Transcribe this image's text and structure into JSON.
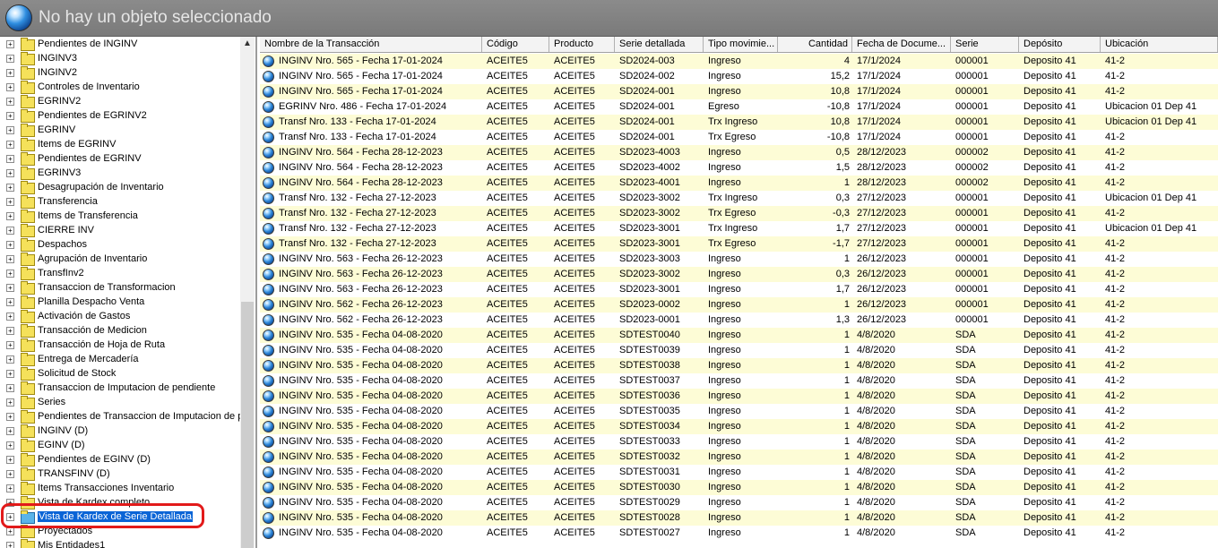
{
  "window": {
    "title": "No hay un objeto seleccionado"
  },
  "tree": {
    "items": [
      {
        "label": "Pendientes de INGINV"
      },
      {
        "label": "INGINV3"
      },
      {
        "label": "INGINV2"
      },
      {
        "label": "Controles de Inventario"
      },
      {
        "label": "EGRINV2"
      },
      {
        "label": "Pendientes de EGRINV2"
      },
      {
        "label": "EGRINV"
      },
      {
        "label": "Items de EGRINV"
      },
      {
        "label": "Pendientes de EGRINV"
      },
      {
        "label": "EGRINV3"
      },
      {
        "label": "Desagrupación de Inventario"
      },
      {
        "label": "Transferencia"
      },
      {
        "label": "Items de Transferencia"
      },
      {
        "label": "CIERRE INV"
      },
      {
        "label": "Despachos"
      },
      {
        "label": "Agrupación de Inventario"
      },
      {
        "label": "TransfInv2"
      },
      {
        "label": "Transaccion de Transformacion"
      },
      {
        "label": "Planilla Despacho Venta"
      },
      {
        "label": "Activación de Gastos"
      },
      {
        "label": "Transacción de Medicion"
      },
      {
        "label": "Transacción de Hoja de Ruta"
      },
      {
        "label": "Entrega de Mercadería"
      },
      {
        "label": "Solicitud de Stock"
      },
      {
        "label": "Transaccion de Imputacion de pendiente"
      },
      {
        "label": "Series"
      },
      {
        "label": "Pendientes de Transaccion de Imputacion de p"
      },
      {
        "label": "INGINV (D)"
      },
      {
        "label": "EGINV (D)"
      },
      {
        "label": "Pendientes de EGINV (D)"
      },
      {
        "label": "TRANSFINV (D)"
      },
      {
        "label": "Items Transacciones Inventario"
      },
      {
        "label": "Vista de Kardex completo"
      },
      {
        "label": "Vista de Kardex de Serie Detallada",
        "selected": true
      },
      {
        "label": "Proyectados"
      },
      {
        "label": "Mis Entidades1"
      }
    ]
  },
  "grid": {
    "columns": [
      "Nombre de la Transacción",
      "Código",
      "Producto",
      "Serie detallada",
      "Tipo movimie...",
      "Cantidad",
      "Fecha de Docume...",
      "Serie",
      "Depósito",
      "Ubicación"
    ],
    "rows": [
      [
        "INGINV Nro.  565 - Fecha 17-01-2024",
        "ACEITE5",
        "ACEITE5",
        "SD2024-003",
        "Ingreso",
        "4",
        "17/1/2024",
        "000001",
        "Deposito 41",
        "41-2"
      ],
      [
        "INGINV Nro.  565 - Fecha 17-01-2024",
        "ACEITE5",
        "ACEITE5",
        "SD2024-002",
        "Ingreso",
        "15,2",
        "17/1/2024",
        "000001",
        "Deposito 41",
        "41-2"
      ],
      [
        "INGINV Nro.  565 - Fecha 17-01-2024",
        "ACEITE5",
        "ACEITE5",
        "SD2024-001",
        "Ingreso",
        "10,8",
        "17/1/2024",
        "000001",
        "Deposito 41",
        "41-2"
      ],
      [
        "EGRINV Nro.  486 - Fecha 17-01-2024",
        "ACEITE5",
        "ACEITE5",
        "SD2024-001",
        "Egreso",
        "-10,8",
        "17/1/2024",
        "000001",
        "Deposito 41",
        "Ubicacion 01 Dep 41"
      ],
      [
        "Transf Nro.  133 - Fecha 17-01-2024",
        "ACEITE5",
        "ACEITE5",
        "SD2024-001",
        "Trx Ingreso",
        "10,8",
        "17/1/2024",
        "000001",
        "Deposito 41",
        "Ubicacion 01 Dep 41"
      ],
      [
        "Transf Nro.  133 - Fecha 17-01-2024",
        "ACEITE5",
        "ACEITE5",
        "SD2024-001",
        "Trx Egreso",
        "-10,8",
        "17/1/2024",
        "000001",
        "Deposito 41",
        "41-2"
      ],
      [
        "INGINV Nro.  564 - Fecha 28-12-2023",
        "ACEITE5",
        "ACEITE5",
        "SD2023-4003",
        "Ingreso",
        "0,5",
        "28/12/2023",
        "000002",
        "Deposito 41",
        "41-2"
      ],
      [
        "INGINV Nro.  564 - Fecha 28-12-2023",
        "ACEITE5",
        "ACEITE5",
        "SD2023-4002",
        "Ingreso",
        "1,5",
        "28/12/2023",
        "000002",
        "Deposito 41",
        "41-2"
      ],
      [
        "INGINV Nro.  564 - Fecha 28-12-2023",
        "ACEITE5",
        "ACEITE5",
        "SD2023-4001",
        "Ingreso",
        "1",
        "28/12/2023",
        "000002",
        "Deposito 41",
        "41-2"
      ],
      [
        "Transf Nro.  132 - Fecha 27-12-2023",
        "ACEITE5",
        "ACEITE5",
        "SD2023-3002",
        "Trx Ingreso",
        "0,3",
        "27/12/2023",
        "000001",
        "Deposito 41",
        "Ubicacion 01 Dep 41"
      ],
      [
        "Transf Nro.  132 - Fecha 27-12-2023",
        "ACEITE5",
        "ACEITE5",
        "SD2023-3002",
        "Trx Egreso",
        "-0,3",
        "27/12/2023",
        "000001",
        "Deposito 41",
        "41-2"
      ],
      [
        "Transf Nro.  132 - Fecha 27-12-2023",
        "ACEITE5",
        "ACEITE5",
        "SD2023-3001",
        "Trx Ingreso",
        "1,7",
        "27/12/2023",
        "000001",
        "Deposito 41",
        "Ubicacion 01 Dep 41"
      ],
      [
        "Transf Nro.  132 - Fecha 27-12-2023",
        "ACEITE5",
        "ACEITE5",
        "SD2023-3001",
        "Trx Egreso",
        "-1,7",
        "27/12/2023",
        "000001",
        "Deposito 41",
        "41-2"
      ],
      [
        "INGINV Nro.  563 - Fecha 26-12-2023",
        "ACEITE5",
        "ACEITE5",
        "SD2023-3003",
        "Ingreso",
        "1",
        "26/12/2023",
        "000001",
        "Deposito 41",
        "41-2"
      ],
      [
        "INGINV Nro.  563 - Fecha 26-12-2023",
        "ACEITE5",
        "ACEITE5",
        "SD2023-3002",
        "Ingreso",
        "0,3",
        "26/12/2023",
        "000001",
        "Deposito 41",
        "41-2"
      ],
      [
        "INGINV Nro.  563 - Fecha 26-12-2023",
        "ACEITE5",
        "ACEITE5",
        "SD2023-3001",
        "Ingreso",
        "1,7",
        "26/12/2023",
        "000001",
        "Deposito 41",
        "41-2"
      ],
      [
        "INGINV Nro.  562 - Fecha 26-12-2023",
        "ACEITE5",
        "ACEITE5",
        "SD2023-0002",
        "Ingreso",
        "1",
        "26/12/2023",
        "000001",
        "Deposito 41",
        "41-2"
      ],
      [
        "INGINV Nro.  562 - Fecha 26-12-2023",
        "ACEITE5",
        "ACEITE5",
        "SD2023-0001",
        "Ingreso",
        "1,3",
        "26/12/2023",
        "000001",
        "Deposito 41",
        "41-2"
      ],
      [
        "INGINV Nro.  535 - Fecha 04-08-2020",
        "ACEITE5",
        "ACEITE5",
        "SDTEST0040",
        "Ingreso",
        "1",
        "4/8/2020",
        "SDA",
        "Deposito 41",
        "41-2"
      ],
      [
        "INGINV Nro.  535 - Fecha 04-08-2020",
        "ACEITE5",
        "ACEITE5",
        "SDTEST0039",
        "Ingreso",
        "1",
        "4/8/2020",
        "SDA",
        "Deposito 41",
        "41-2"
      ],
      [
        "INGINV Nro.  535 - Fecha 04-08-2020",
        "ACEITE5",
        "ACEITE5",
        "SDTEST0038",
        "Ingreso",
        "1",
        "4/8/2020",
        "SDA",
        "Deposito 41",
        "41-2"
      ],
      [
        "INGINV Nro.  535 - Fecha 04-08-2020",
        "ACEITE5",
        "ACEITE5",
        "SDTEST0037",
        "Ingreso",
        "1",
        "4/8/2020",
        "SDA",
        "Deposito 41",
        "41-2"
      ],
      [
        "INGINV Nro.  535 - Fecha 04-08-2020",
        "ACEITE5",
        "ACEITE5",
        "SDTEST0036",
        "Ingreso",
        "1",
        "4/8/2020",
        "SDA",
        "Deposito 41",
        "41-2"
      ],
      [
        "INGINV Nro.  535 - Fecha 04-08-2020",
        "ACEITE5",
        "ACEITE5",
        "SDTEST0035",
        "Ingreso",
        "1",
        "4/8/2020",
        "SDA",
        "Deposito 41",
        "41-2"
      ],
      [
        "INGINV Nro.  535 - Fecha 04-08-2020",
        "ACEITE5",
        "ACEITE5",
        "SDTEST0034",
        "Ingreso",
        "1",
        "4/8/2020",
        "SDA",
        "Deposito 41",
        "41-2"
      ],
      [
        "INGINV Nro.  535 - Fecha 04-08-2020",
        "ACEITE5",
        "ACEITE5",
        "SDTEST0033",
        "Ingreso",
        "1",
        "4/8/2020",
        "SDA",
        "Deposito 41",
        "41-2"
      ],
      [
        "INGINV Nro.  535 - Fecha 04-08-2020",
        "ACEITE5",
        "ACEITE5",
        "SDTEST0032",
        "Ingreso",
        "1",
        "4/8/2020",
        "SDA",
        "Deposito 41",
        "41-2"
      ],
      [
        "INGINV Nro.  535 - Fecha 04-08-2020",
        "ACEITE5",
        "ACEITE5",
        "SDTEST0031",
        "Ingreso",
        "1",
        "4/8/2020",
        "SDA",
        "Deposito 41",
        "41-2"
      ],
      [
        "INGINV Nro.  535 - Fecha 04-08-2020",
        "ACEITE5",
        "ACEITE5",
        "SDTEST0030",
        "Ingreso",
        "1",
        "4/8/2020",
        "SDA",
        "Deposito 41",
        "41-2"
      ],
      [
        "INGINV Nro.  535 - Fecha 04-08-2020",
        "ACEITE5",
        "ACEITE5",
        "SDTEST0029",
        "Ingreso",
        "1",
        "4/8/2020",
        "SDA",
        "Deposito 41",
        "41-2"
      ],
      [
        "INGINV Nro.  535 - Fecha 04-08-2020",
        "ACEITE5",
        "ACEITE5",
        "SDTEST0028",
        "Ingreso",
        "1",
        "4/8/2020",
        "SDA",
        "Deposito 41",
        "41-2"
      ],
      [
        "INGINV Nro.  535 - Fecha 04-08-2020",
        "ACEITE5",
        "ACEITE5",
        "SDTEST0027",
        "Ingreso",
        "1",
        "4/8/2020",
        "SDA",
        "Deposito 41",
        "41-2"
      ]
    ]
  },
  "colors": {
    "selection": "#0a64d6",
    "row_alt": "#fdfcd6",
    "highlight_box": "#e21a1a"
  },
  "icons": {
    "app": "globe-icon",
    "tree_node": "folder-icon",
    "row": "globe-icon"
  }
}
